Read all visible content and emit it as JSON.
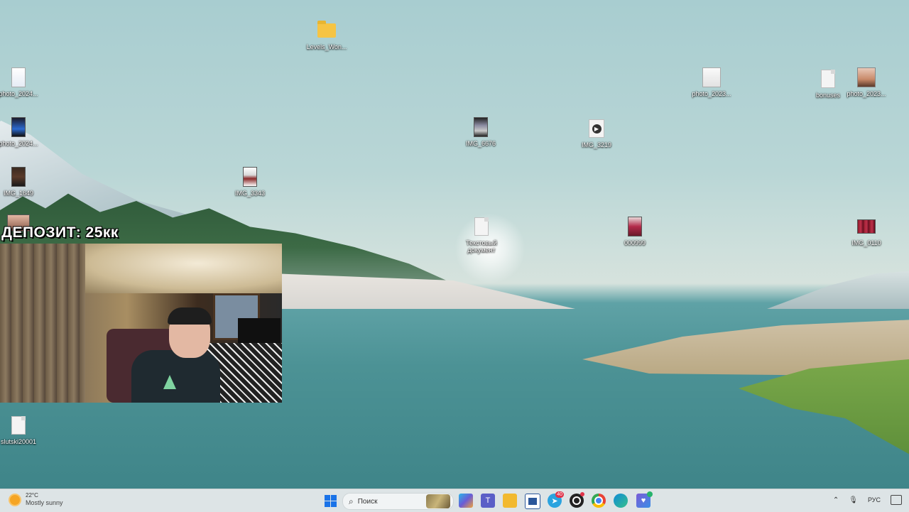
{
  "overlay": {
    "deposit_text": "ДЕПОЗИТ: 25кк"
  },
  "desktop_icons": [
    {
      "label": "Levels_Won...",
      "type": "folder"
    },
    {
      "label": "photo_2024...",
      "type": "photo"
    },
    {
      "label": "photo_2024...",
      "type": "photo"
    },
    {
      "label": "IMG_1649",
      "type": "photo"
    },
    {
      "label": "IMG_3343",
      "type": "photo"
    },
    {
      "label": "IMG_6676",
      "type": "photo"
    },
    {
      "label": "IMG_3219",
      "type": "video"
    },
    {
      "label": "Текстовый документ",
      "type": "text"
    },
    {
      "label": "000999",
      "type": "photo"
    },
    {
      "label": "photo_2023...",
      "type": "photo"
    },
    {
      "label": "bonuses",
      "type": "text"
    },
    {
      "label": "photo_2023...",
      "type": "photo"
    },
    {
      "label": "IMG_0110",
      "type": "video"
    },
    {
      "label": "slutski20001",
      "type": "text"
    }
  ],
  "taskbar": {
    "weather": {
      "temp": "22°C",
      "condition": "Mostly sunny",
      "icon": "sun-icon"
    },
    "search_placeholder": "Поиск",
    "pinned": [
      {
        "name": "copilot",
        "color": "#3a8ee6"
      },
      {
        "name": "teams",
        "color": "#5b5fc7",
        "glyph": "T"
      },
      {
        "name": "file-explorer",
        "color": "#f2b92f"
      },
      {
        "name": "app-window",
        "color": "#2b579a"
      },
      {
        "name": "telegram",
        "color": "#2aa3df",
        "badge": "40"
      },
      {
        "name": "obs",
        "color": "#222222"
      },
      {
        "name": "chrome",
        "color": "#e94235"
      },
      {
        "name": "edge",
        "color": "#0f8bd8"
      },
      {
        "name": "vpn",
        "color": "#7b5cd6"
      }
    ],
    "tray": {
      "language": "РУС"
    }
  },
  "colors": {
    "taskbar_bg": "#dde4e6",
    "accent": "#1a73e8"
  }
}
